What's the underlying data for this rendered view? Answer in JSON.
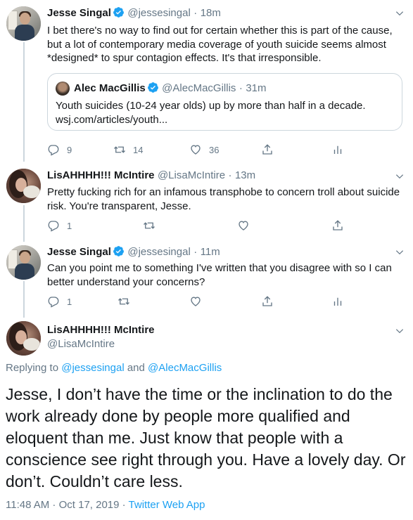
{
  "tweets": [
    {
      "name": "Jesse Singal",
      "handle": "@jessesingal",
      "time": "18m",
      "text": "I bet there's no way to find out for certain whether this is part of the cause, but a lot of contemporary media coverage of youth suicide seems almost *designed* to spur  contagion effects. It's that irresponsible.",
      "quote": {
        "name": "Alec MacGillis",
        "handle": "@AlecMacGillis",
        "time": "31m",
        "text": "Youth suicides (10-24 year olds) up by more than half in a decade.",
        "link": "wsj.com/articles/youth..."
      },
      "replies": "9",
      "retweets": "14",
      "likes": "36"
    },
    {
      "name": "LisAHHHH!!! McIntire",
      "handle": "@LisaMcIntire",
      "time": "13m",
      "text": "Pretty fucking rich for an infamous transphobe to concern troll about suicide risk. You're transparent, Jesse.",
      "replies": "1"
    },
    {
      "name": "Jesse Singal",
      "handle": "@jessesingal",
      "time": "11m",
      "text": "Can you point me to something I've written that you disagree with so I can better understand your concerns?",
      "replies": "1"
    }
  ],
  "focus": {
    "name": "LisAHHHH!!! McIntire",
    "handle": "@LisaMcIntire",
    "replying_prefix": "Replying to",
    "replying_to_1": "@jessesingal",
    "replying_and": "and",
    "replying_to_2": "@AlecMacGillis",
    "text": "Jesse, I don’t have the time or the inclination to do the work already done by people more qualified and eloquent than me. Just know that people with a conscience see right through you. Have a lovely day. Or don’t. Couldn’t care less.",
    "timestamp": "11:48 AM · Oct 17, 2019 · ",
    "source": "Twitter Web App"
  },
  "separator": "·",
  "icons": [
    "verified-icon",
    "chevron-down-icon",
    "reply-icon",
    "retweet-icon",
    "like-icon",
    "share-icon",
    "analytics-icon"
  ],
  "colors": {
    "accent": "#1da1f2",
    "muted": "#657786",
    "text": "#14171a",
    "border": "#ccd6dd"
  }
}
